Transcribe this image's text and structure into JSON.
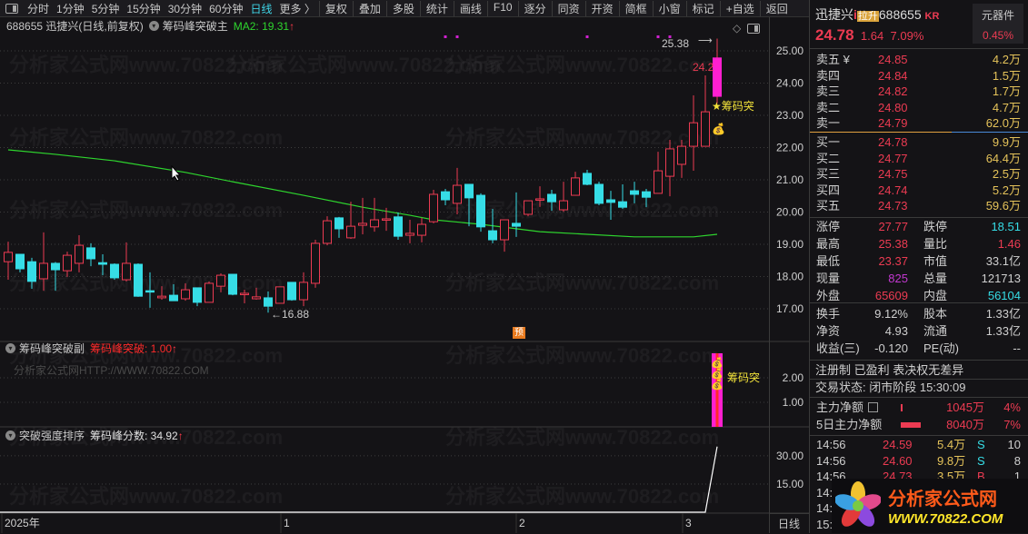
{
  "toolbar": {
    "periods": [
      "分时",
      "1分钟",
      "5分钟",
      "15分钟",
      "30分钟",
      "60分钟",
      "日线",
      "更多 〉"
    ],
    "active_period": "日线",
    "tools": [
      "复权",
      "叠加",
      "多股",
      "统计",
      "画线",
      "F10",
      "逐分",
      "同资",
      "开资",
      "简框",
      "小窗",
      "标记",
      "+自选",
      "返回"
    ]
  },
  "main_panel": {
    "title": "688655 迅捷兴(日线,前复权)",
    "indicator": "筹码峰突破主",
    "ma_label": "MA2: 19.31",
    "high_label": "25.38",
    "low_label": "16.88",
    "last_label": "24.2",
    "signal_label": "★筹码突",
    "badge": "预",
    "y_ticks": [
      "25.00",
      "24.00",
      "23.00",
      "22.00",
      "21.00",
      "20.00",
      "19.00",
      "18.00",
      "17.00"
    ]
  },
  "sub1": {
    "name": "筹码峰突破副",
    "value_label": "筹码峰突破: 1.00",
    "watermark": "分析家公式网HTTP://WWW.70822.COM",
    "signal_label": "筹码突",
    "y_ticks": [
      "2.00",
      "1.00"
    ]
  },
  "sub2": {
    "name": "突破强度排序",
    "value_label": "筹码峰分数: 34.92",
    "y_ticks": [
      "30.00",
      "15.00"
    ]
  },
  "xaxis": {
    "labels": [
      "2025年",
      "1",
      "2",
      "3"
    ],
    "period": "日线"
  },
  "watermark": "分析家公式网www.70822.com",
  "colors": {
    "up": "#ec3b52",
    "down": "#36dde6",
    "ma": "#2ed52e",
    "signal": "#ff1fd0",
    "bg": "#141316"
  },
  "chart_data": {
    "type": "candlestick",
    "price_range": [
      16.6,
      25.6
    ],
    "candles": [
      [
        18.46,
        19.08,
        17.9,
        18.75
      ],
      [
        18.69,
        18.69,
        18.13,
        18.24
      ],
      [
        18.46,
        18.58,
        17.62,
        17.85
      ],
      [
        17.93,
        19.37,
        17.56,
        18.41
      ],
      [
        18.41,
        18.45,
        17.56,
        18.21
      ],
      [
        18.18,
        18.77,
        17.99,
        18.66
      ],
      [
        18.41,
        19.28,
        18.13,
        18.97
      ],
      [
        18.89,
        19.03,
        18.32,
        18.55
      ],
      [
        18.43,
        18.69,
        18.04,
        18.38
      ],
      [
        18.38,
        18.41,
        17.9,
        17.96
      ],
      [
        17.9,
        19.06,
        17.85,
        18.41
      ],
      [
        18.38,
        18.41,
        17.37,
        17.39
      ],
      [
        17.56,
        18.13,
        17.03,
        17.52
      ],
      [
        17.34,
        17.7,
        17.28,
        17.39
      ],
      [
        17.42,
        17.76,
        17.25,
        17.25
      ],
      [
        17.31,
        17.79,
        17.25,
        17.59
      ],
      [
        17.65,
        17.65,
        17.08,
        17.2
      ],
      [
        17.2,
        17.85,
        17.2,
        17.79
      ],
      [
        17.7,
        18.1,
        17.51,
        18.04
      ],
      [
        18.07,
        18.07,
        17.42,
        17.45
      ],
      [
        17.45,
        17.59,
        17.17,
        17.48
      ],
      [
        17.31,
        17.65,
        17.28,
        17.37
      ],
      [
        17.34,
        17.54,
        16.88,
        17.08
      ],
      [
        17.17,
        17.68,
        17.17,
        17.68
      ],
      [
        17.82,
        17.82,
        17.25,
        17.28
      ],
      [
        17.28,
        18.13,
        17.08,
        17.82
      ],
      [
        17.79,
        19.14,
        17.65,
        19.03
      ],
      [
        19.03,
        19.87,
        18.97,
        19.73
      ],
      [
        19.82,
        19.85,
        19.2,
        19.48
      ],
      [
        19.2,
        20.32,
        19.17,
        19.56
      ],
      [
        19.59,
        20.44,
        19.31,
        19.65
      ],
      [
        19.54,
        20.44,
        19.39,
        19.76
      ],
      [
        19.76,
        20.13,
        19.42,
        19.79
      ],
      [
        19.85,
        19.99,
        19.14,
        19.25
      ],
      [
        19.28,
        19.76,
        19.03,
        19.34
      ],
      [
        19.28,
        19.82,
        19.06,
        19.62
      ],
      [
        19.7,
        20.69,
        19.65,
        20.55
      ],
      [
        20.63,
        20.72,
        20.21,
        20.38
      ],
      [
        20.27,
        21.37,
        19.93,
        20.83
      ],
      [
        20.86,
        20.86,
        19.56,
        20.44
      ],
      [
        20.52,
        20.58,
        19.39,
        19.54
      ],
      [
        19.42,
        20.1,
        19.03,
        19.14
      ],
      [
        19.14,
        19.76,
        18.77,
        19.76
      ],
      [
        19.65,
        20.61,
        19.23,
        19.56
      ],
      [
        19.93,
        20.35,
        19.87,
        20.35
      ],
      [
        20.38,
        20.8,
        20.16,
        20.41
      ],
      [
        20.55,
        20.69,
        20.04,
        20.32
      ],
      [
        20.07,
        20.94,
        20.01,
        20.35
      ],
      [
        20.52,
        21.25,
        20.52,
        21.06
      ],
      [
        21.2,
        21.31,
        20.83,
        20.86
      ],
      [
        20.86,
        20.94,
        20.21,
        20.27
      ],
      [
        20.38,
        20.66,
        19.76,
        20.3
      ],
      [
        20.32,
        20.86,
        20.1,
        20.15
      ],
      [
        20.66,
        20.94,
        20.27,
        20.55
      ],
      [
        20.63,
        20.72,
        20.15,
        20.46
      ],
      [
        20.58,
        21.87,
        20.58,
        21.28
      ],
      [
        21.11,
        22.24,
        20.49,
        21.96
      ],
      [
        21.48,
        22.24,
        21.06,
        22.04
      ],
      [
        22.04,
        23.62,
        21.28,
        22.77
      ],
      [
        22.04,
        24.24,
        22.04,
        23.11
      ],
      [
        23.59,
        25.38,
        23.37,
        24.78
      ]
    ],
    "candle_fields": [
      "open",
      "high",
      "low",
      "close"
    ],
    "ma2_points": [
      [
        0,
        21.93
      ],
      [
        4,
        21.79
      ],
      [
        9,
        21.59
      ],
      [
        15,
        21.23
      ],
      [
        19,
        20.94
      ],
      [
        25,
        20.52
      ],
      [
        30,
        20.15
      ],
      [
        34,
        19.9
      ],
      [
        36,
        19.76
      ],
      [
        40,
        19.62
      ],
      [
        45,
        19.39
      ],
      [
        49,
        19.31
      ],
      [
        53,
        19.23
      ],
      [
        58,
        19.23
      ],
      [
        60,
        19.31
      ]
    ],
    "top_markers": [
      37,
      38,
      49,
      55,
      56
    ],
    "sub1_range": [
      0,
      3.3
    ],
    "sub1_signal": {
      "index": 60,
      "value": 3.0
    },
    "sub2_range": [
      0,
      36
    ],
    "sub2_scores": {
      "index_start": 59,
      "values": [
        0,
        34.92
      ]
    }
  },
  "quote": {
    "name": "迅捷兴",
    "info_mark": "i",
    "tag": "拉升",
    "code": "688655",
    "kr": "KR",
    "sector": "元器件",
    "sector_change": "0.45%",
    "price": "24.78",
    "change": "1.64",
    "change_pct": "7.09%",
    "asks": [
      {
        "label": "卖五 ¥",
        "price": "24.85",
        "vol": "4.2万"
      },
      {
        "label": "卖四",
        "price": "24.84",
        "vol": "1.5万"
      },
      {
        "label": "卖三",
        "price": "24.82",
        "vol": "1.7万"
      },
      {
        "label": "卖二",
        "price": "24.80",
        "vol": "4.7万"
      },
      {
        "label": "卖一",
        "price": "24.79",
        "vol": "62.0万"
      }
    ],
    "bids": [
      {
        "label": "买一",
        "price": "24.78",
        "vol": "9.9万"
      },
      {
        "label": "买二",
        "price": "24.77",
        "vol": "64.4万"
      },
      {
        "label": "买三",
        "price": "24.75",
        "vol": "2.5万"
      },
      {
        "label": "买四",
        "price": "24.74",
        "vol": "5.2万"
      },
      {
        "label": "买五",
        "price": "24.73",
        "vol": "59.6万"
      }
    ],
    "stats": [
      [
        "涨停",
        "27.77",
        "跌停",
        "18.51"
      ],
      [
        "最高",
        "25.38",
        "量比",
        "1.46"
      ],
      [
        "最低",
        "23.37",
        "市值",
        "33.1亿"
      ],
      [
        "现量",
        "825",
        "总量",
        "121713"
      ],
      [
        "外盘",
        "65609",
        "内盘",
        "56104"
      ],
      [
        "换手",
        "9.12%",
        "股本",
        "1.33亿"
      ],
      [
        "净资",
        "4.93",
        "流通",
        "1.33亿"
      ],
      [
        "收益(三)",
        "-0.120",
        "PE(动)",
        "--"
      ]
    ],
    "tags_line": "注册制 已盈利 表决权无差异",
    "status_line": "交易状态: 闭市阶段 15:30:09",
    "flows": [
      {
        "label": "主力净额",
        "amount": "1045万",
        "pct": "4%"
      },
      {
        "label": "5日主力净额",
        "amount": "8040万",
        "pct": "7%"
      }
    ],
    "ticks": [
      {
        "time": "14:56",
        "price": "24.59",
        "vol": "5.4万",
        "side": "S",
        "count": "10"
      },
      {
        "time": "14:56",
        "price": "24.60",
        "vol": "9.8万",
        "side": "S",
        "count": "8"
      },
      {
        "time": "14:56",
        "price": "24.73",
        "vol": "3.5万",
        "side": "B",
        "count": "1"
      },
      {
        "time": "14:5"
      },
      {
        "time": "14:5"
      },
      {
        "time": "15:0"
      }
    ]
  },
  "logo": {
    "title": "分析家公式网",
    "url": "WWW.70822.COM"
  }
}
